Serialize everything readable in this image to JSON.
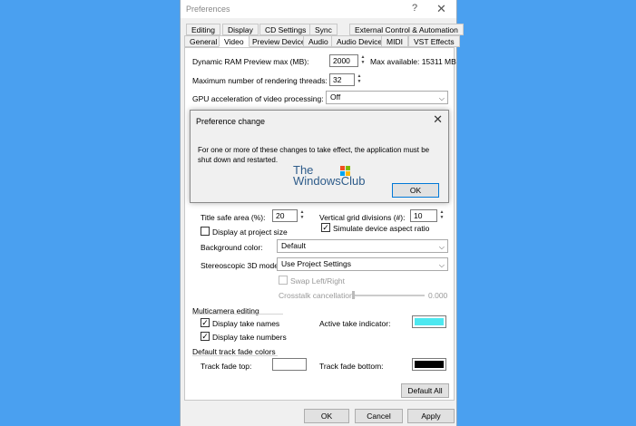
{
  "window": {
    "title": "Preferences",
    "help_icon": "?",
    "close_icon": "✕"
  },
  "tabs_row1": [
    "Editing",
    "Display",
    "CD Settings",
    "Sync",
    "External Control & Automation"
  ],
  "tabs_row2": [
    "General",
    "Video",
    "Preview Device",
    "Audio",
    "Audio Device",
    "MIDI",
    "VST Effects"
  ],
  "active_tab": "Video",
  "video": {
    "ram_label": "Dynamic RAM Preview max (MB):",
    "ram_value": "2000",
    "ram_max": "Max available: 15311 MB",
    "threads_label": "Maximum number of rendering threads:",
    "threads_value": "32",
    "gpu_label": "GPU acceleration of video processing:",
    "gpu_value": "Off"
  },
  "preview": {
    "title_safe_label": "Title safe area (%):",
    "title_safe_value": "20",
    "vgrid_label": "Vertical grid divisions (#):",
    "vgrid_value": "10",
    "display_project_size": "Display at project size",
    "simulate_aspect": "Simulate device aspect ratio",
    "bg_color_label": "Background color:",
    "bg_color_value": "Default",
    "stereo_label": "Stereoscopic 3D mode:",
    "stereo_value": "Use Project Settings",
    "swap_lr": "Swap Left/Right",
    "crosstalk_label": "Crosstalk cancellation:",
    "crosstalk_value": "0.000"
  },
  "multicam": {
    "header": "Multicamera editing",
    "display_names": "Display take names",
    "display_numbers": "Display take numbers",
    "indicator_label": "Active take indicator:",
    "indicator_color": "#4de8f0"
  },
  "fades": {
    "header": "Default track fade colors",
    "top_label": "Track fade top:",
    "top_color": "#ffffff",
    "bottom_label": "Track fade bottom:",
    "bottom_color": "#000000"
  },
  "buttons": {
    "default_all": "Default All",
    "ok": "OK",
    "cancel": "Cancel",
    "apply": "Apply"
  },
  "dialog": {
    "title": "Preference change",
    "close_icon": "✕",
    "message": "For one or more of these changes to take effect, the application must be shut down and restarted.",
    "ok": "OK"
  },
  "watermark": {
    "line1": "The",
    "line2": "WindowsClub"
  }
}
